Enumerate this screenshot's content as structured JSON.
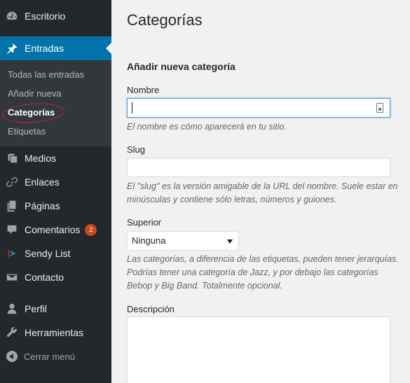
{
  "sidebar": {
    "items": [
      {
        "label": "Escritorio",
        "icon": "dashboard-icon"
      },
      {
        "label": "Entradas",
        "icon": "pin-icon",
        "active": true
      },
      {
        "label": "Medios",
        "icon": "media-icon"
      },
      {
        "label": "Enlaces",
        "icon": "link-icon"
      },
      {
        "label": "Páginas",
        "icon": "pages-icon"
      },
      {
        "label": "Comentarios",
        "icon": "comment-icon",
        "badge": "2"
      },
      {
        "label": "Sendy List",
        "icon": "sendy-icon"
      },
      {
        "label": "Contacto",
        "icon": "mail-icon"
      },
      {
        "label": "Perfil",
        "icon": "user-icon"
      },
      {
        "label": "Herramientas",
        "icon": "wrench-icon"
      }
    ],
    "submenu": [
      "Todas las entradas",
      "Añadir nueva",
      "Categorías",
      "Etiquetas"
    ],
    "collapse_label": "Cerrar menú"
  },
  "main": {
    "page_title": "Categorías",
    "section_title": "Añadir nueva categoría",
    "name_label": "Nombre",
    "name_value": "",
    "name_help": "El nombre es cómo aparecerá en tu sitio.",
    "slug_label": "Slug",
    "slug_value": "",
    "slug_help": "El \"slug\" es la versión amigable de la URL del nombre. Suele estar en minúsculas y contiene sólo letras, números y guiones.",
    "parent_label": "Superior",
    "parent_selected": "Ninguna",
    "parent_help": "Las categorías, a diferencia de las etiquetas, pueden tener jerarquías. Podrías tener una categoría de Jazz, y por debajo las categorías Bebop y Big Band. Totalmente opcional.",
    "description_label": "Descripción"
  },
  "colors": {
    "sidebar_bg": "#23282d",
    "accent": "#0073aa",
    "badge": "#ca4a1f",
    "annotation_circle": "#d0262b"
  }
}
